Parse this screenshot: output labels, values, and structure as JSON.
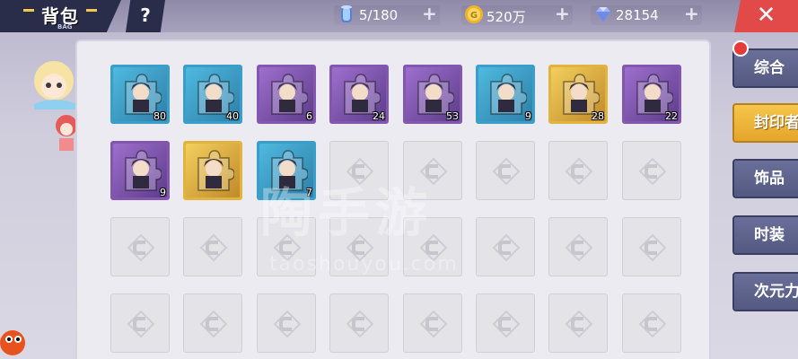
{
  "header": {
    "title": "背包",
    "subtitle": "BAG",
    "help_label": "?",
    "close_label": "✕"
  },
  "resources": [
    {
      "name": "stamina",
      "icon": "energy-cylinder-icon",
      "value": "5/180"
    },
    {
      "name": "gold",
      "icon": "gold-coin-icon",
      "value": "520万"
    },
    {
      "name": "diamond",
      "icon": "diamond-icon",
      "value": "28154"
    }
  ],
  "plus_label": "+",
  "side_tabs": [
    {
      "label": "综合",
      "active": false
    },
    {
      "label": "封印者",
      "active": true
    },
    {
      "label": "饰品",
      "active": false
    },
    {
      "label": "时装",
      "active": false
    },
    {
      "label": "次元力",
      "active": false
    }
  ],
  "items": [
    {
      "count": "80",
      "rarity": "blue"
    },
    {
      "count": "40",
      "rarity": "blue"
    },
    {
      "count": "6",
      "rarity": "purple"
    },
    {
      "count": "24",
      "rarity": "purple"
    },
    {
      "count": "53",
      "rarity": "purple"
    },
    {
      "count": "9",
      "rarity": "blue"
    },
    {
      "count": "28",
      "rarity": "gold"
    },
    {
      "count": "22",
      "rarity": "purple"
    },
    {
      "count": "9",
      "rarity": "purple"
    },
    {
      "count": "",
      "rarity": "gold"
    },
    {
      "count": "7",
      "rarity": "blue"
    }
  ],
  "watermark": {
    "text": "陶手游",
    "url": "taoshouyou.com"
  },
  "colors": {
    "accent": "#f6c64b",
    "close": "#e24a4a",
    "blue": "#3a9fc8",
    "purple": "#8356b0",
    "gold": "#e2b43d"
  }
}
